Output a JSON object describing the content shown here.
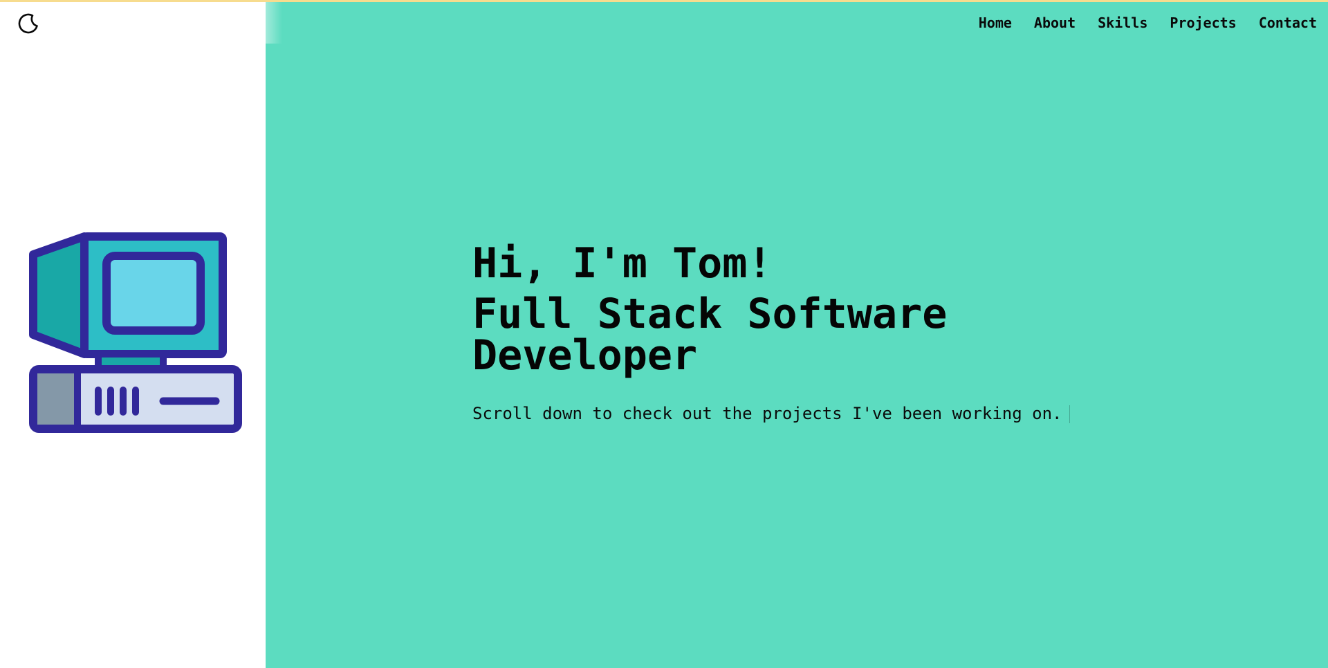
{
  "theme": {
    "hero_background": "#5cdcc0",
    "top_accent": "#f7dc8e",
    "illustration_outline": "#31289a",
    "illustration_teal": "#19a8a6",
    "illustration_screen": "#69d5e9",
    "illustration_bezel": "#2dbec6",
    "illustration_panel": "#d4def0",
    "illustration_drive": "#8498a8"
  },
  "nav": {
    "theme_toggle_icon": "moon-icon",
    "links": [
      {
        "label": "Home"
      },
      {
        "label": "About"
      },
      {
        "label": "Skills"
      },
      {
        "label": "Projects"
      },
      {
        "label": "Contact"
      }
    ]
  },
  "hero": {
    "illustration_icon": "desktop-computer-icon",
    "greeting": "Hi, I'm Tom!",
    "role": "Full Stack Software Developer",
    "tagline": "Scroll down to check out the projects I've been working on."
  }
}
